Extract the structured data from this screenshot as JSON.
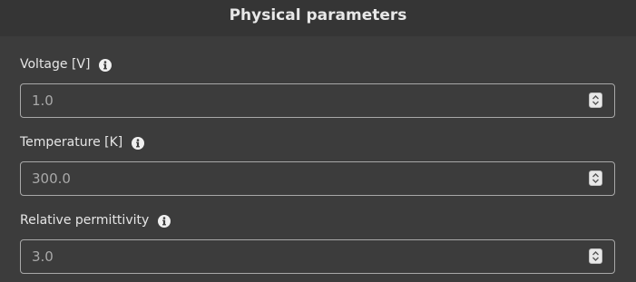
{
  "panel": {
    "title": "Physical parameters"
  },
  "fields": [
    {
      "label": "Voltage [V]",
      "value": "1.0",
      "info_icon": "info-icon"
    },
    {
      "label": "Temperature [K]",
      "value": "300.0",
      "info_icon": "info-icon"
    },
    {
      "label": "Relative permittivity",
      "value": "3.0",
      "info_icon": "info-icon"
    }
  ],
  "colors": {
    "background": "#3c3c3c",
    "header": "#353535",
    "text": "#e8e8e8",
    "input_text": "#a9a9a9",
    "input_border": "#a8a8a8"
  }
}
